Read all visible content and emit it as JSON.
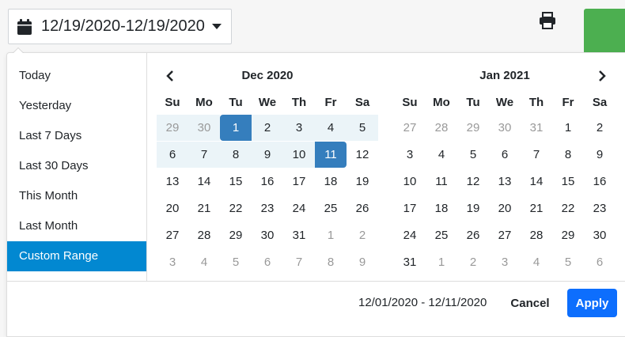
{
  "trigger": {
    "value": "12/19/2020-12/19/2020",
    "icon": "calendar-icon"
  },
  "toolbar": {
    "print_icon": "printer-icon",
    "accent_color": "#4caf50"
  },
  "ranges": {
    "items": [
      "Today",
      "Yesterday",
      "Last 7 Days",
      "Last 30 Days",
      "This Month",
      "Last Month",
      "Custom Range"
    ],
    "active": "Custom Range"
  },
  "weekdays": [
    "Su",
    "Mo",
    "Tu",
    "We",
    "Th",
    "Fr",
    "Sa"
  ],
  "calendars": [
    {
      "title": "Dec 2020",
      "weeks": [
        [
          "29",
          "30",
          "1",
          "2",
          "3",
          "4",
          "5"
        ],
        [
          "6",
          "7",
          "8",
          "9",
          "10",
          "11",
          "12"
        ],
        [
          "13",
          "14",
          "15",
          "16",
          "17",
          "18",
          "19"
        ],
        [
          "20",
          "21",
          "22",
          "23",
          "24",
          "25",
          "26"
        ],
        [
          "27",
          "28",
          "29",
          "30",
          "31",
          "1",
          "2"
        ],
        [
          "3",
          "4",
          "5",
          "6",
          "7",
          "8",
          "9"
        ]
      ]
    },
    {
      "title": "Jan 2021",
      "weeks": [
        [
          "27",
          "28",
          "29",
          "30",
          "31",
          "1",
          "2"
        ],
        [
          "3",
          "4",
          "5",
          "6",
          "7",
          "8",
          "9"
        ],
        [
          "10",
          "11",
          "12",
          "13",
          "14",
          "15",
          "16"
        ],
        [
          "17",
          "18",
          "19",
          "20",
          "21",
          "22",
          "23"
        ],
        [
          "24",
          "25",
          "26",
          "27",
          "28",
          "29",
          "30"
        ],
        [
          "31",
          "1",
          "2",
          "3",
          "4",
          "5",
          "6"
        ]
      ]
    }
  ],
  "selection": {
    "start": "12/01/2020",
    "end": "12/11/2020",
    "label": "12/01/2020 - 12/11/2020"
  },
  "buttons": {
    "cancel": "Cancel",
    "apply": "Apply"
  },
  "colors": {
    "selected": "#357ebd",
    "in_range": "#ebf4f8",
    "active_range": "#0288d1",
    "apply": "#0d6efd"
  }
}
